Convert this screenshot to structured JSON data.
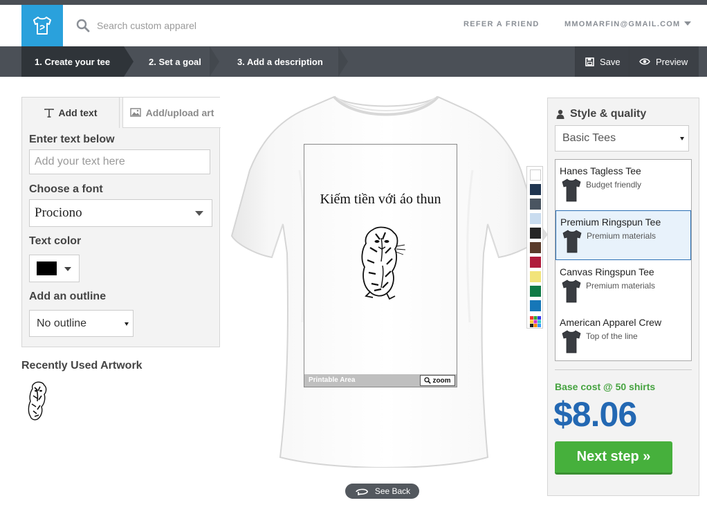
{
  "header": {
    "search_placeholder": "Search custom apparel",
    "refer_link": "REFER A FRIEND",
    "account_email": "MMOMARFIN@GMAIL.COM",
    "logo_icon": "tshirt-icon"
  },
  "steps": [
    {
      "label": "1. Create your tee",
      "active": true
    },
    {
      "label": "2. Set a goal",
      "active": false
    },
    {
      "label": "3. Add a description",
      "active": false
    }
  ],
  "toolbar": {
    "save_label": "Save",
    "preview_label": "Preview"
  },
  "left_panel": {
    "tab_text": "Add text",
    "tab_art": "Add/upload art",
    "enter_text_label": "Enter text below",
    "text_placeholder": "Add your text here",
    "font_label": "Choose a font",
    "font_value": "Prociono",
    "color_label": "Text color",
    "color_value": "#000000",
    "outline_label": "Add an outline",
    "outline_value": "No outline"
  },
  "recent": {
    "title": "Recently Used Artwork"
  },
  "canvas": {
    "design_text": "Kiếm tiền với áo thun",
    "printable_area_label": "Printable Area",
    "zoom_label": "zoom",
    "see_back_label": "See Back"
  },
  "palette_colors": [
    "#ffffff",
    "#1f3550",
    "#4a5561",
    "#c9dcef",
    "#262626",
    "#5a3b2b",
    "#b01c3c",
    "#f2e47a",
    "#0f7a46",
    "#1677b8"
  ],
  "right_panel": {
    "title": "Style & quality",
    "type_value": "Basic Tees",
    "products": [
      {
        "name": "Hanes Tagless Tee",
        "desc": "Budget friendly"
      },
      {
        "name": "Premium Ringspun Tee",
        "desc": "Premium materials"
      },
      {
        "name": "Canvas Ringspun Tee",
        "desc": "Premium materials"
      },
      {
        "name": "American Apparel Crew",
        "desc": "Top of the line"
      }
    ],
    "selected_product": "Premium Ringspun Tee",
    "base_cost_label": "Base cost @ 50 shirts",
    "price": "$8.06",
    "next_label": "Next step »"
  }
}
